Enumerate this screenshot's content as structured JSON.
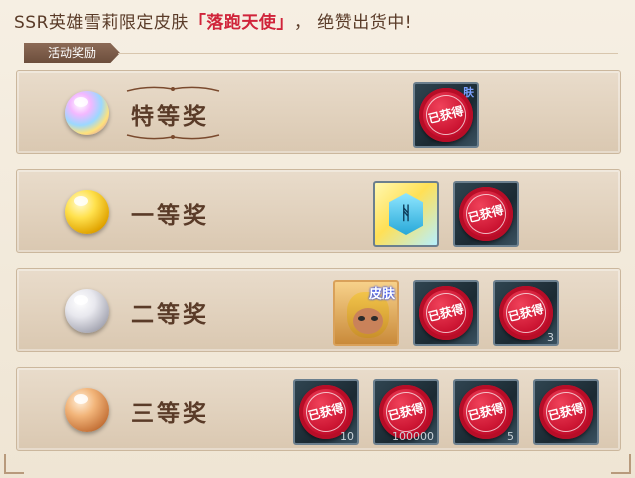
{
  "headline": {
    "prefix": "SSR英雄雪莉限定皮肤",
    "highlight": "「落跑天使」",
    "suffix": "，  绝赞出货中!"
  },
  "section_tag": "活动奖励",
  "seal_label": "已获得",
  "colors": {
    "seal": "#c8102e",
    "highlight_text": "#d0243a",
    "brown_text": "#5a3b28"
  },
  "rows": [
    {
      "rank": "特等奖",
      "orb": "rainbow-orb",
      "items": [
        {
          "icon": "reward-box-icon",
          "corner": "肤",
          "claimed": true
        }
      ]
    },
    {
      "rank": "一等奖",
      "orb": "gold-orb",
      "items": [
        {
          "icon": "rune-stone-icon",
          "claimed": false
        },
        {
          "icon": "reward-box-icon",
          "claimed": true
        }
      ]
    },
    {
      "rank": "二等奖",
      "orb": "silver-orb",
      "items": [
        {
          "icon": "hero-skin-portrait",
          "badge": "皮肤",
          "claimed": false
        },
        {
          "icon": "reward-box-icon",
          "claimed": true
        },
        {
          "icon": "reward-box-icon",
          "claimed": true,
          "corner": "3"
        }
      ]
    },
    {
      "rank": "三等奖",
      "orb": "bronze-orb",
      "items": [
        {
          "icon": "reward-box-icon",
          "claimed": true,
          "corner": "10"
        },
        {
          "icon": "reward-box-icon",
          "claimed": true,
          "corner": "100000"
        },
        {
          "icon": "reward-box-icon",
          "claimed": true,
          "corner": "5"
        },
        {
          "icon": "reward-box-icon",
          "claimed": true
        }
      ]
    }
  ]
}
